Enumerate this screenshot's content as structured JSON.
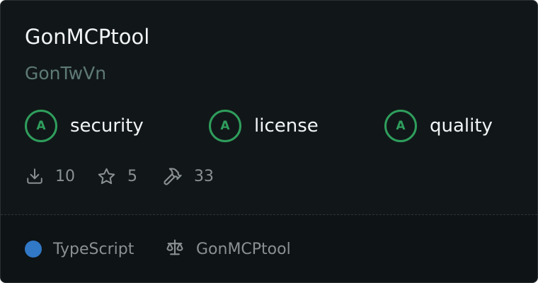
{
  "repo": {
    "name": "GonMCPtool",
    "owner": "GonTwVn"
  },
  "scores": [
    {
      "grade": "A",
      "label": "security"
    },
    {
      "grade": "A",
      "label": "license"
    },
    {
      "grade": "A",
      "label": "quality"
    }
  ],
  "stats": {
    "downloads": "10",
    "stars": "5",
    "tools": "33"
  },
  "footer": {
    "language": "TypeScript",
    "language_color": "#3178c6",
    "license": "GonMCPtool"
  },
  "icons": {
    "downloads": "download-icon",
    "stars": "star-icon",
    "tools": "hammer-icon",
    "license": "scale-icon"
  },
  "colors": {
    "grade_a": "#2f9e5c",
    "card_background": "#111719"
  }
}
